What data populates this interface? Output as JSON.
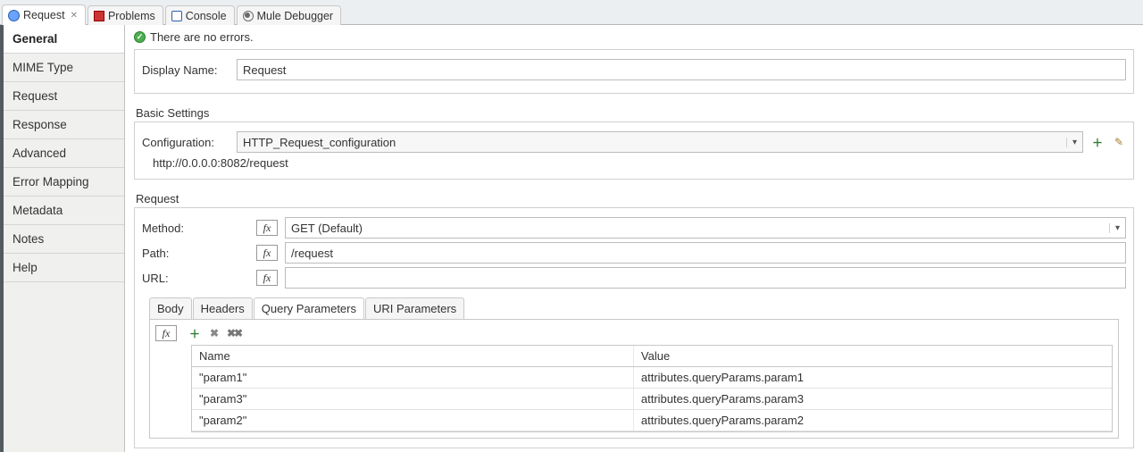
{
  "tabs": {
    "request": {
      "label": "Request"
    },
    "problems": {
      "label": "Problems"
    },
    "console": {
      "label": "Console"
    },
    "debugger": {
      "label": "Mule Debugger"
    }
  },
  "sidebar": {
    "items": [
      {
        "label": "General"
      },
      {
        "label": "MIME Type"
      },
      {
        "label": "Request"
      },
      {
        "label": "Response"
      },
      {
        "label": "Advanced"
      },
      {
        "label": "Error Mapping"
      },
      {
        "label": "Metadata"
      },
      {
        "label": "Notes"
      },
      {
        "label": "Help"
      }
    ]
  },
  "status": {
    "text": "There are no errors."
  },
  "form": {
    "display_name_label": "Display Name:",
    "display_name_value": "Request"
  },
  "basic": {
    "legend": "Basic Settings",
    "config_label": "Configuration:",
    "config_value": "HTTP_Request_configuration",
    "url_preview": "http://0.0.0.0:8082/request"
  },
  "request": {
    "legend": "Request",
    "method_label": "Method:",
    "method_value": "GET (Default)",
    "path_label": "Path:",
    "path_value": "/request",
    "url_label": "URL:",
    "url_value": ""
  },
  "inner_tabs": {
    "body": "Body",
    "headers": "Headers",
    "query": "Query Parameters",
    "uri": "URI Parameters"
  },
  "params_table": {
    "col_name": "Name",
    "col_value": "Value",
    "rows": [
      {
        "name": "\"param1\"",
        "value": "attributes.queryParams.param1"
      },
      {
        "name": "\"param3\"",
        "value": "attributes.queryParams.param3"
      },
      {
        "name": "\"param2\"",
        "value": "attributes.queryParams.param2"
      }
    ]
  },
  "fx": "fx"
}
